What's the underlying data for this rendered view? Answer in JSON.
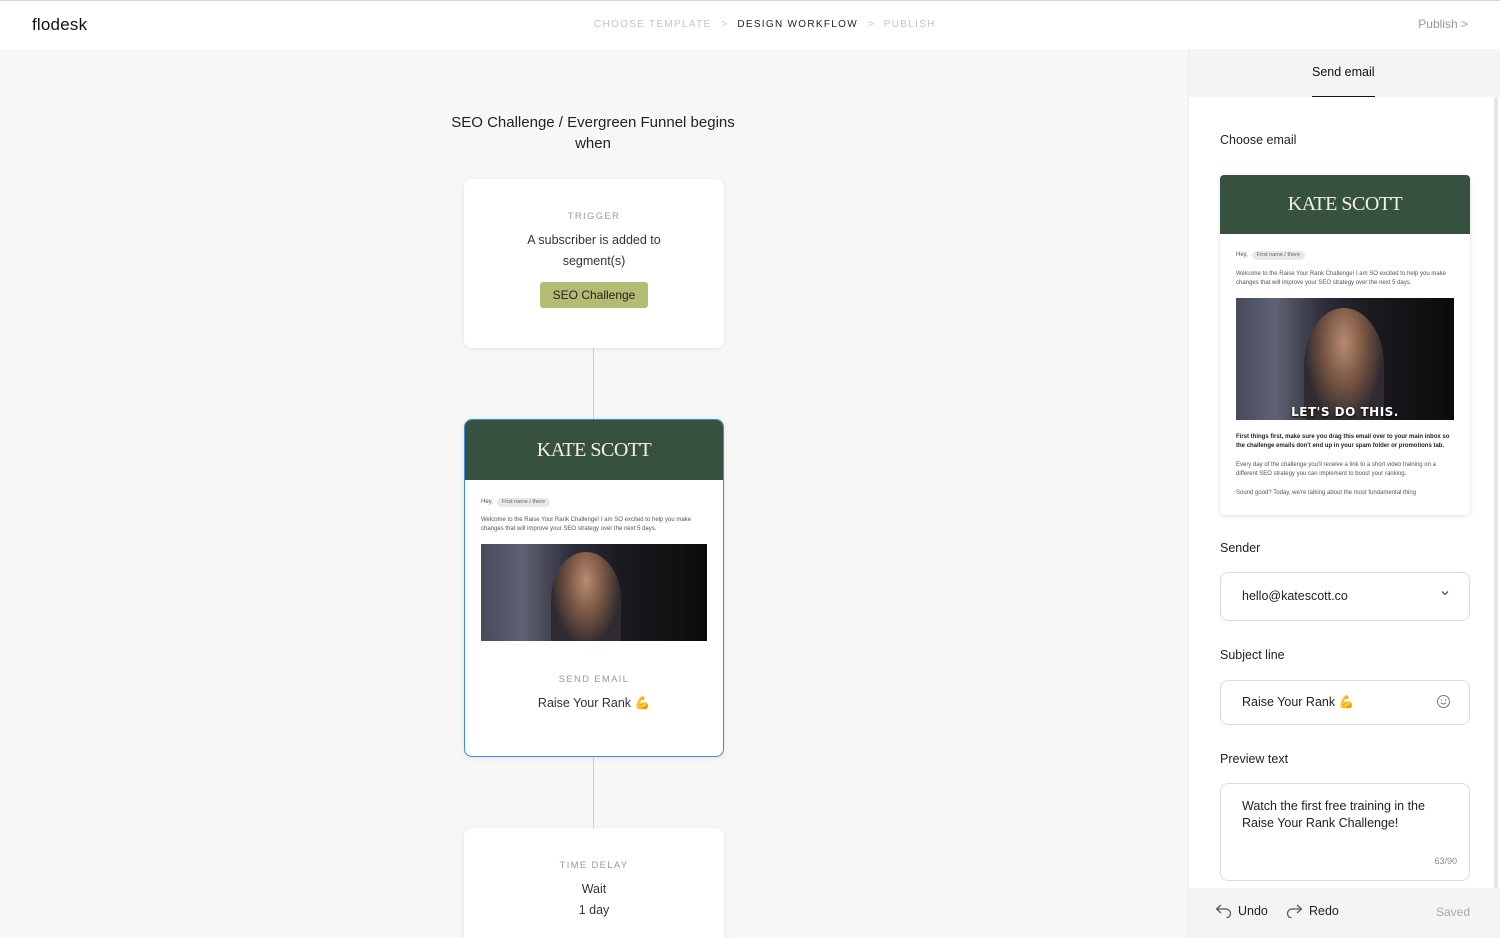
{
  "app": {
    "logo": "flodesk"
  },
  "header": {
    "steps": [
      {
        "label": "CHOOSE TEMPLATE",
        "active": false
      },
      {
        "label": "DESIGN WORKFLOW",
        "active": true
      },
      {
        "label": "PUBLISH",
        "active": false
      }
    ],
    "step_separator": ">",
    "publish_label": "Publish >"
  },
  "workflow": {
    "title": "SEO Challenge / Evergreen Funnel begins when",
    "trigger": {
      "label": "TRIGGER",
      "text": "A subscriber is added to segment(s)",
      "segment": "SEO Challenge",
      "segment_color": "#b3bc72"
    },
    "send_email": {
      "label": "SEND EMAIL",
      "subject": "Raise Your Rank 💪"
    },
    "time_delay": {
      "label": "TIME DELAY",
      "line1": "Wait",
      "line2": "1 day"
    }
  },
  "email_preview": {
    "brand": "KATE SCOTT",
    "brand_bg": "#36513f",
    "hey": "Hey,",
    "merge_tag": "First name / there",
    "intro": "Welcome to the Raise Your Rank Challenge! I am SO excited to help you make changes that will improve your SEO strategy over the next 5 days.",
    "gif_caption": "LET'S DO THIS.",
    "bold_paragraph": "First things first, make sure you drag this email over to your main inbox so the challenge emails don't end up in your spam folder or promotions tab.",
    "paragraph2": "Every day of the challenge you'll receive a link to a short video training on a different SEO strategy you can implement to boost your ranking.",
    "paragraph3": "Sound good? Today, we're talking about the most fundamental thing"
  },
  "panel": {
    "tab": "Send email",
    "choose_email_label": "Choose email",
    "sender_label": "Sender",
    "sender_value": "hello@katescott.co",
    "subject_label": "Subject line",
    "subject_value": "Raise Your Rank 💪",
    "preview_label": "Preview text",
    "preview_value": "Watch the first free training in the Raise Your Rank Challenge!",
    "preview_counter": "63/90",
    "undo": "Undo",
    "redo": "Redo",
    "saved": "Saved"
  }
}
